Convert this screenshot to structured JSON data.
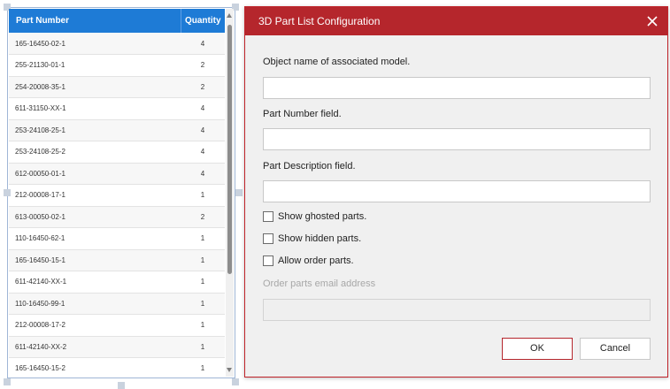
{
  "parts_table": {
    "columns": [
      "Part Number",
      "Quantity"
    ],
    "rows": [
      {
        "part_number": "165-16450-02-1",
        "quantity": "4"
      },
      {
        "part_number": "255-21130-01-1",
        "quantity": "2"
      },
      {
        "part_number": "254-20008-35-1",
        "quantity": "2"
      },
      {
        "part_number": "611-31150-XX-1",
        "quantity": "4"
      },
      {
        "part_number": "253-24108-25-1",
        "quantity": "4"
      },
      {
        "part_number": "253-24108-25-2",
        "quantity": "4"
      },
      {
        "part_number": "612-00050-01-1",
        "quantity": "4"
      },
      {
        "part_number": "212-00008-17-1",
        "quantity": "1"
      },
      {
        "part_number": "613-00050-02-1",
        "quantity": "2"
      },
      {
        "part_number": "110-16450-62-1",
        "quantity": "1"
      },
      {
        "part_number": "165-16450-15-1",
        "quantity": "1"
      },
      {
        "part_number": "611-42140-XX-1",
        "quantity": "1"
      },
      {
        "part_number": "110-16450-99-1",
        "quantity": "1"
      },
      {
        "part_number": "212-00008-17-2",
        "quantity": "1"
      },
      {
        "part_number": "611-42140-XX-2",
        "quantity": "1"
      },
      {
        "part_number": "165-16450-15-2",
        "quantity": "1"
      }
    ]
  },
  "dialog": {
    "title": "3D Part List Configuration",
    "close_icon": "close-icon",
    "fields": {
      "object_name_label": "Object name of associated model.",
      "object_name_value": "",
      "part_number_label": "Part Number field.",
      "part_number_value": "",
      "part_description_label": "Part Description field.",
      "part_description_value": "",
      "email_label": "Order parts email address",
      "email_value": ""
    },
    "checkboxes": {
      "show_ghosted": "Show ghosted parts.",
      "show_hidden": "Show hidden parts.",
      "allow_order": "Allow order parts."
    },
    "buttons": {
      "ok": "OK",
      "cancel": "Cancel"
    }
  },
  "colors": {
    "table_header": "#1e7bd6",
    "dialog_title_bar": "#b5262c"
  }
}
